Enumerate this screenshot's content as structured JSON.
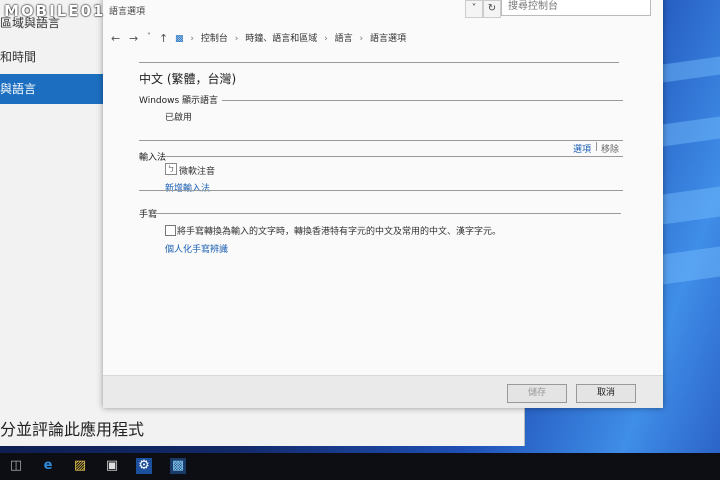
{
  "watermark": "MOBILE01",
  "background_window": {
    "sidebar_items": [
      "區域與語言",
      "和時間",
      "與語言"
    ],
    "footer_text": "分並評論此應用程式"
  },
  "dialog": {
    "title": "語言選項",
    "search_placeholder": "搜尋控制台",
    "breadcrumb": [
      "控制台",
      "時鐘、語言和區域",
      "語言",
      "語言選項"
    ],
    "language_name": "中文 (繁體，台灣)",
    "display_language": {
      "title": "Windows 顯示語言",
      "status": "已啟用"
    },
    "input_method": {
      "title": "輸入法",
      "ime_name": "微軟注音",
      "options_link": "選項",
      "separator": "|",
      "remove_link": "移除",
      "add_link": "新增輸入法"
    },
    "handwriting": {
      "title": "手寫",
      "checkbox_label": "將手寫轉換為輸入的文字時，轉換香港特有字元的中文及常用的中文、漢字字元。",
      "checkbox_checked": false,
      "personalize_link": "個人化手寫辨識"
    },
    "buttons": {
      "save": "儲存",
      "cancel": "取消"
    }
  },
  "colors": {
    "link": "#1a5fb4",
    "accent": "#1c6fc0"
  },
  "icons": {
    "back": "←",
    "forward": "→",
    "recent": "˅",
    "up": "↑",
    "refresh": "↻",
    "dropdown": "˅",
    "breadcrumb_sep": "›",
    "taskbar": [
      "task-view-icon",
      "edge-icon",
      "file-explorer-icon",
      "store-icon",
      "settings-icon",
      "control-panel-icon"
    ]
  }
}
